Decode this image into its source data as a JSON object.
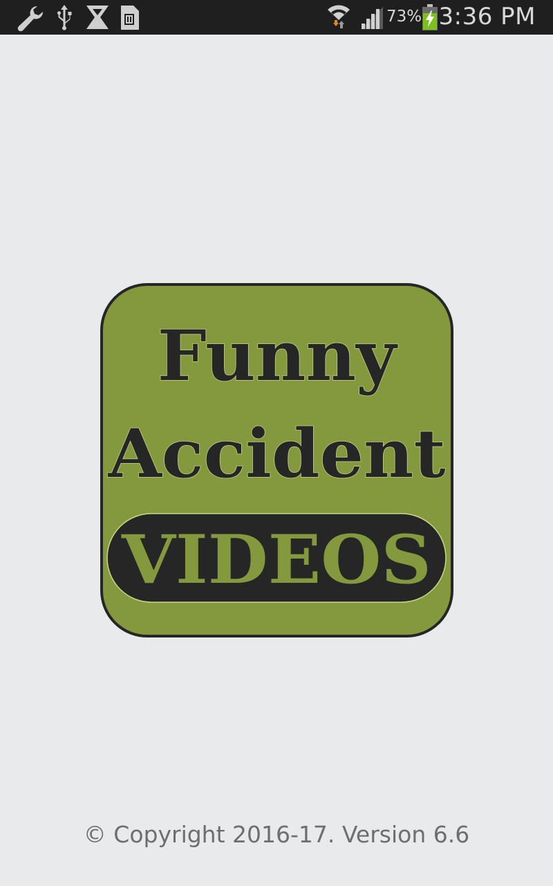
{
  "status_bar": {
    "battery_percent": "73%",
    "time": "3:36 PM",
    "battery_level": 0.73,
    "icons": [
      "wrench-icon",
      "usb-icon",
      "hourglass-icon",
      "sd-card-icon",
      "wifi-icon",
      "signal-icon",
      "battery-charging-icon"
    ]
  },
  "logo": {
    "line1": "Funny",
    "line2": "Accident",
    "badge": "VIDEOS",
    "colors": {
      "tile": "#84993d",
      "ink": "#262626",
      "badge_text": "#84993d"
    }
  },
  "footer": {
    "copyright": "© Copyright 2016-17. Version 6.6"
  }
}
